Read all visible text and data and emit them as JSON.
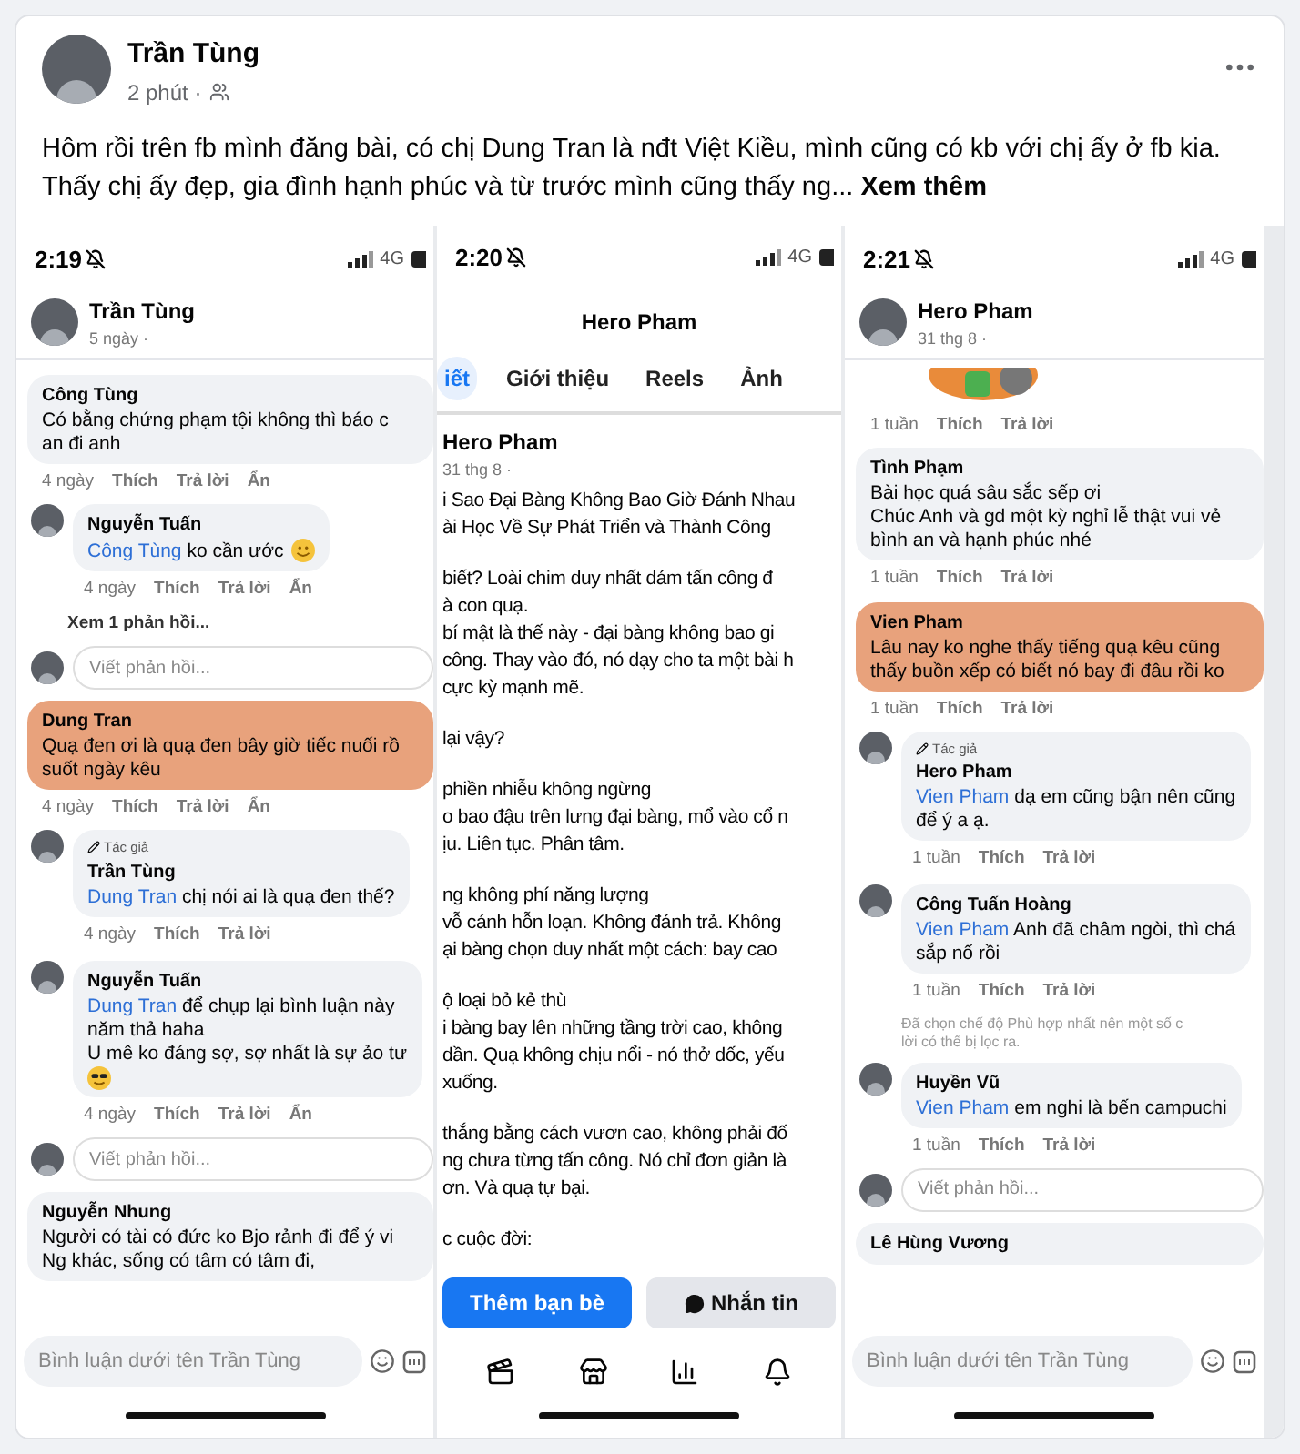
{
  "post": {
    "author": "Trần Tùng",
    "time": "2 phút ·",
    "text": "Hôm rồi trên fb mình đăng bài, có chị Dung Tran là nđt Việt Kiều, mình cũng có kb với chị ấy ở fb kia. Thấy chị ấy đẹp, gia đình hạnh phúc và từ trước mình cũng thấy ng...",
    "more": "Xem thêm"
  },
  "phones": [
    {
      "kind": "comments",
      "status": {
        "time": "2:19",
        "network": "4G"
      },
      "header": {
        "name": "Trần Tùng",
        "time": "5 ngày ·"
      },
      "items": [
        {
          "kind": "comment",
          "author": "Công Tùng",
          "lines": [
            "Có bằng chứng phạm tội không thì báo c",
            "an đi anh"
          ],
          "highlighted": false,
          "actions": [
            "4 ngày",
            "Thích",
            "Trả lời",
            "Ẩn"
          ]
        },
        {
          "kind": "reply",
          "author": "Nguyễn Tuấn",
          "mention": "Công Tùng",
          "lines": [
            "ko cần ước"
          ],
          "emoji": {
            "kind": "yum"
          },
          "highlighted": false,
          "actions": [
            "4 ngày",
            "Thích",
            "Trả lời",
            "Ẩn"
          ]
        },
        {
          "kind": "link",
          "text": "Xem 1 phản hồi..."
        },
        {
          "kind": "reply_field",
          "placeholder": "Viết phản hồi..."
        },
        {
          "kind": "comment",
          "author": "Dung Tran",
          "lines": [
            "Quạ đen ơi là quạ đen bây giờ tiếc nuối rồ",
            "suốt ngày kêu"
          ],
          "highlighted": true,
          "actions": [
            "4 ngày",
            "Thích",
            "Trả lời",
            "Ẩn"
          ]
        },
        {
          "kind": "reply",
          "badge": "Tác giả",
          "author": "Trần Tùng",
          "mention": "Dung Tran",
          "lines": [
            "chị nói ai là quạ đen thế?"
          ],
          "highlighted": false,
          "actions": [
            "4 ngày",
            "Thích",
            "Trả lời"
          ]
        },
        {
          "kind": "reply",
          "author": "Nguyễn Tuấn",
          "mention": "Dung Tran",
          "lines": [
            "để chụp lại bình luận này",
            "năm thả haha",
            "U mê ko đáng sợ, sợ nhất là sự ảo tư"
          ],
          "emoji": {
            "kind": "cool"
          },
          "highlighted": false,
          "actions": [
            "4 ngày",
            "Thích",
            "Trả lời",
            "Ẩn"
          ]
        },
        {
          "kind": "reply_field",
          "placeholder": "Viết phản hồi..."
        },
        {
          "kind": "comment",
          "author": "Nguyễn Nhung",
          "lines": [
            "Người có tài có đức ko Bjo rảnh đi để ý vi",
            "Ng khác, sống có tâm có tâm đi,"
          ],
          "highlighted": false
        }
      ],
      "composer": {
        "placeholder": "Bình luận dưới tên Trần Tùng"
      }
    },
    {
      "kind": "profile",
      "status": {
        "time": "2:20",
        "network": "4G"
      },
      "title": "Hero Pham",
      "tabs": [
        {
          "label": "iết",
          "selected": true
        },
        {
          "label": "Giới thiệu",
          "selected": false
        },
        {
          "label": "Reels",
          "selected": false
        },
        {
          "label": "Ảnh",
          "selected": false
        }
      ],
      "header": {
        "name": "Hero Pham",
        "time": "31 thg 8 ·"
      },
      "paragraphs": [
        [
          "i Sao Đại Bàng Không Bao Giờ Đánh Nhau",
          "ài Học Về Sự Phát Triển và Thành Công"
        ],
        [
          "biết? Loài chim duy nhất dám tấn công đ",
          "à con quạ.",
          "bí mật là thế này - đại bàng không bao gi",
          "công. Thay vào đó, nó dạy cho ta một bài h",
          "cực kỳ mạnh mẽ."
        ],
        [
          "lại vậy?"
        ],
        [
          "phiền nhiễu không ngừng",
          "o bao đậu trên lưng đại bàng, mổ vào cổ n",
          "ịu. Liên tục. Phân tâm."
        ],
        [
          "ng không phí năng lượng",
          "vỗ cánh hỗn loạn. Không đánh trả. Không",
          "ại bàng chọn duy nhất một cách: bay cao"
        ],
        [
          "ộ loại bỏ kẻ thù",
          "i bàng bay lên những tầng trời cao, không",
          "dần. Quạ không chịu nổi - nó thở dốc, yếu",
          "xuống."
        ],
        [
          "thắng bằng cách vươn cao, không phải đố",
          "ng chưa từng tấn công. Nó chỉ đơn giản là",
          "ơn. Và quạ tự bại."
        ],
        [
          "c cuộc đời:"
        ]
      ],
      "buttons": [
        {
          "kind": "primary",
          "label": "Thêm bạn bè"
        },
        {
          "kind": "secondary",
          "label": "Nhắn tin"
        }
      ]
    },
    {
      "kind": "comments",
      "status": {
        "time": "2:21",
        "network": "4G"
      },
      "header": {
        "name": "Hero Pham",
        "time": "31 thg 8 ·"
      },
      "items": [
        {
          "kind": "sticker",
          "actions": [
            "1 tuần",
            "Thích",
            "Trả lời"
          ]
        },
        {
          "kind": "comment",
          "author": "Tình Phạm",
          "lines": [
            "Bài học quá sâu sắc sếp ơi",
            "Chúc Anh và gd một kỳ nghỉ lễ thật vui vẻ",
            "bình an và hạnh phúc nhé"
          ],
          "highlighted": false,
          "actions": [
            "1 tuần",
            "Thích",
            "Trả lời"
          ]
        },
        {
          "kind": "comment",
          "author": "Vien Pham",
          "lines": [
            "Lâu nay ko nghe thấy tiếng quạ kêu cũng",
            "thấy buồn xếp có biết nó bay đi đâu rồi ko"
          ],
          "highlighted": true,
          "actions": [
            "1 tuần",
            "Thích",
            "Trả lời"
          ]
        },
        {
          "kind": "reply",
          "badge": "Tác giả",
          "author": "Hero Pham",
          "mention": "Vien Pham",
          "lines": [
            "dạ em cũng bận nên cũng",
            "để ý a ạ."
          ],
          "highlighted": false,
          "actions": [
            "1 tuần",
            "Thích",
            "Trả lời"
          ]
        },
        {
          "kind": "reply",
          "author": "Công Tuấn Hoàng",
          "mention": "Vien Pham",
          "lines": [
            "Anh đã châm ngòi, thì chá",
            "sắp nổ rồi"
          ],
          "highlighted": false,
          "actions": [
            "1 tuần",
            "Thích",
            "Trả lời"
          ]
        },
        {
          "kind": "note",
          "lines": [
            "Đã chọn chế độ Phù hợp nhất nên một số c",
            "lời có thể bị lọc ra."
          ]
        },
        {
          "kind": "reply",
          "author": "Huyền Vũ",
          "mention": "Vien Pham",
          "lines": [
            "em nghi là bến campuchi"
          ],
          "highlighted": false,
          "actions": [
            "1 tuần",
            "Thích",
            "Trả lời"
          ]
        },
        {
          "kind": "reply_field",
          "placeholder": "Viết phản hồi..."
        },
        {
          "kind": "comment",
          "author": "Lê Hùng Vương",
          "highlighted": false
        }
      ],
      "composer": {
        "placeholder": "Bình luận dưới tên Trần Tùng"
      }
    }
  ]
}
